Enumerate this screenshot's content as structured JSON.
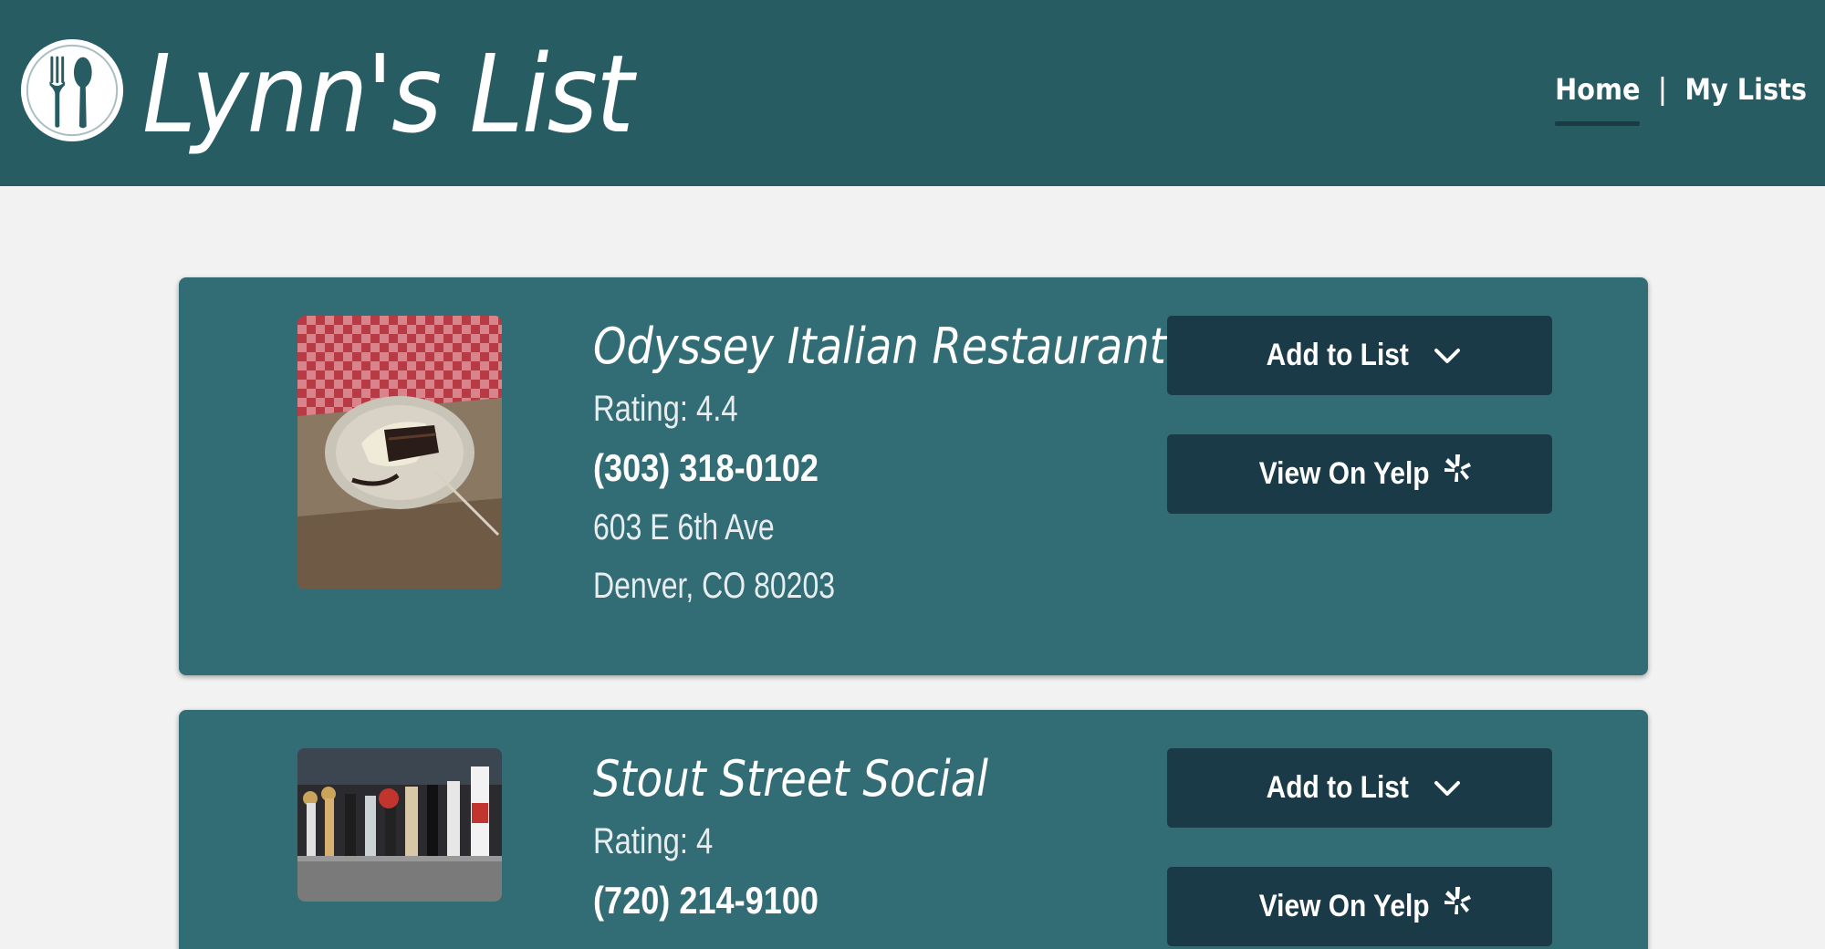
{
  "brand": {
    "title": "Lynn's List"
  },
  "nav": {
    "home": "Home",
    "separator": "|",
    "my_lists": "My Lists"
  },
  "restaurants": [
    {
      "name": "Odyssey Italian Restaurant",
      "rating": "Rating: 4.4",
      "phone": "(303) 318-0102",
      "address1": "603 E 6th Ave",
      "address2": "Denver, CO 80203",
      "add_label": "Add to List",
      "yelp_label": "View On Yelp"
    },
    {
      "name": "Stout Street Social",
      "rating": "Rating: 4",
      "phone": "(720) 214-9100",
      "add_label": "Add to List",
      "yelp_label": "View On Yelp"
    }
  ],
  "colors": {
    "header": "#275c63",
    "card": "#326d76",
    "button": "#1b3a47",
    "page": "#f2f2f2"
  }
}
